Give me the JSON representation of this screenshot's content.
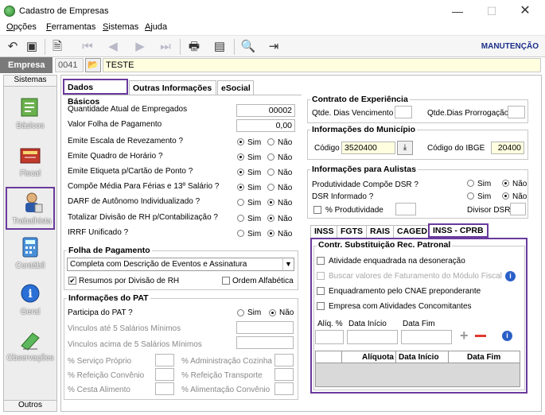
{
  "window": {
    "title": "Cadastro de Empresas"
  },
  "menu": [
    {
      "label": "Opções",
      "u": "O",
      "rest": "pções"
    },
    {
      "label": "Ferramentas",
      "u": "F",
      "rest": "erramentas"
    },
    {
      "label": "Sistemas",
      "u": "S",
      "rest": "istemas"
    },
    {
      "label": "Ajuda",
      "u": "A",
      "rest": "juda"
    }
  ],
  "toolbar": {
    "mode": "MANUTENÇÃO"
  },
  "empresa": {
    "label": "Empresa",
    "code": "0041",
    "name": "TESTE"
  },
  "sidebar": {
    "header": "Sistemas",
    "footer": "Outros",
    "items": [
      {
        "label": "Básicos",
        "icon": "basicos-icon"
      },
      {
        "label": "Fiscal",
        "icon": "fiscal-icon"
      },
      {
        "label": "Trabalhista",
        "icon": "trabalhista-icon"
      },
      {
        "label": "Contábil",
        "icon": "contabil-icon"
      },
      {
        "label": "Geral",
        "icon": "geral-icon"
      },
      {
        "label": "Observações",
        "icon": "observacoes-icon"
      }
    ]
  },
  "tabs": [
    "Dados Básicos",
    "Outras Informações",
    "eSocial"
  ],
  "left": {
    "qtd_label": "Quantidade Atual de Empregados",
    "qtd_value": "00002",
    "folha_label": "Valor Folha de Pagamento",
    "folha_value": "0,00",
    "yes": "Sim",
    "no": "Não",
    "questions": [
      "Emite Escala de Revezamento ?",
      "Emite Quadro de Horário ?",
      "Emite Etiqueta p/Cartão de Ponto ?",
      "Compõe Média Para Férias e 13º Salário ?",
      "DARF de Autônomo Individualizado ?",
      "Totalizar Divisão de RH p/Contabilização ?",
      "IRRF Unificado ?"
    ],
    "answers": [
      "Sim",
      "Sim",
      "Sim",
      "Sim",
      "Não",
      "Não",
      "Não"
    ]
  },
  "folha": {
    "title": "Folha de Pagamento",
    "select_value": "Completa com Descrição de Eventos e Assinatura",
    "resumos": "Resumos por Divisão de RH",
    "ordem": "Ordem Alfabética"
  },
  "pat": {
    "title": "Informações do PAT",
    "participa": "Participa do PAT ?",
    "vinc_ate": "Vinculos até 5 Salários Mínimos",
    "vinc_acima": "Vinculos acima de 5 Salários Mínimos",
    "servico": "% Serviço Próprio",
    "adm": "% Administração Cozinha",
    "refeicao_conv": "% Refeição Convênio",
    "refeicao_transp": "% Refeição Transporte",
    "cesta": "% Cesta Alimento",
    "alim_conv": "% Alimentação Convênio"
  },
  "experiencia": {
    "title": "Contrato de Experiência",
    "dias": "Qtde. Dias Vencimento",
    "prorrog": "Qtde.Dias Prorrogação"
  },
  "municipio": {
    "title": "Informações do Município",
    "codigo_label": "Código",
    "codigo_value": "3520400",
    "ibge_label": "Código do IBGE",
    "ibge_value": "20400"
  },
  "aulistas": {
    "title": "Informações para Aulistas",
    "dsr_compoe": "Produtividade Compõe DSR ?",
    "dsr_informado": "DSR Informado ?",
    "perc_prod": "% Produtividade",
    "divisor": "Divisor DSR"
  },
  "subtabs": [
    "INSS",
    "FGTS",
    "RAIS",
    "CAGED",
    "INSS - CPRB"
  ],
  "cprb": {
    "title": "Contr. Substituição Rec. Patronal",
    "atividade": "Atividade enquadrada na desoneração",
    "buscar": "Buscar valores de Faturamento do Módulo Fiscal",
    "cnae": "Enquadramento pelo CNAE preponderante",
    "concomitantes": "Empresa com Atividades Concomitantes",
    "aliq": "Alíq. %",
    "data_inicio": "Data Início",
    "data_fim": "Data Fim",
    "columns": [
      "Alíquota",
      "Data Início",
      "Data Fim"
    ]
  }
}
